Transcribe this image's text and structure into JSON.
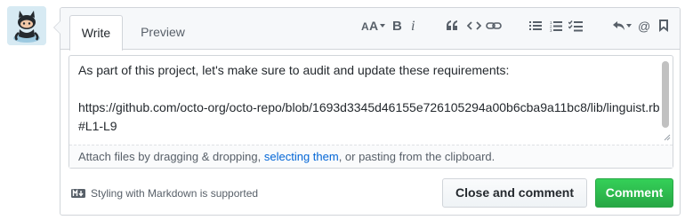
{
  "tabs": {
    "write": "Write",
    "preview": "Preview"
  },
  "toolbar": {
    "icons": [
      "text-size-icon",
      "bold-icon",
      "italic-icon",
      "quote-icon",
      "code-icon",
      "link-icon",
      "unordered-list-icon",
      "ordered-list-icon",
      "task-list-icon",
      "reply-icon",
      "mention-icon",
      "bookmark-icon"
    ]
  },
  "editor": {
    "line1": "As part of this project, let's make sure to audit and update these requirements:",
    "line2": "",
    "line3": "https://github.com/octo-org/octo-repo/blob/1693d3345d46155e726105294a00b6cba9a11bc8/lib/linguist.rb#L1-L9"
  },
  "attach": {
    "prefix": "Attach files by dragging & dropping, ",
    "link": "selecting them",
    "suffix": ", or pasting from the clipboard."
  },
  "footer": {
    "markdown_note": "Styling with Markdown is supported",
    "close_label": "Close and comment",
    "comment_label": "Comment"
  },
  "colors": {
    "accent_link": "#0366d6",
    "primary_button": "#28a745"
  }
}
